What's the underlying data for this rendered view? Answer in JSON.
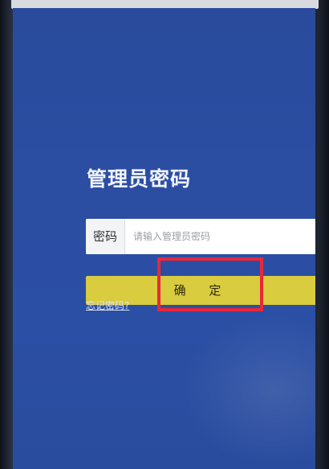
{
  "page": {
    "title": "管理员密码"
  },
  "password_field": {
    "label": "密码",
    "placeholder": "请输入管理员密码",
    "value": ""
  },
  "confirm_button": {
    "label": "确 定"
  },
  "forgot_link": {
    "label": "忘记密码?"
  },
  "colors": {
    "background": "#2b4ea3",
    "button": "#d9cc3e",
    "highlight": "#e8283a"
  }
}
